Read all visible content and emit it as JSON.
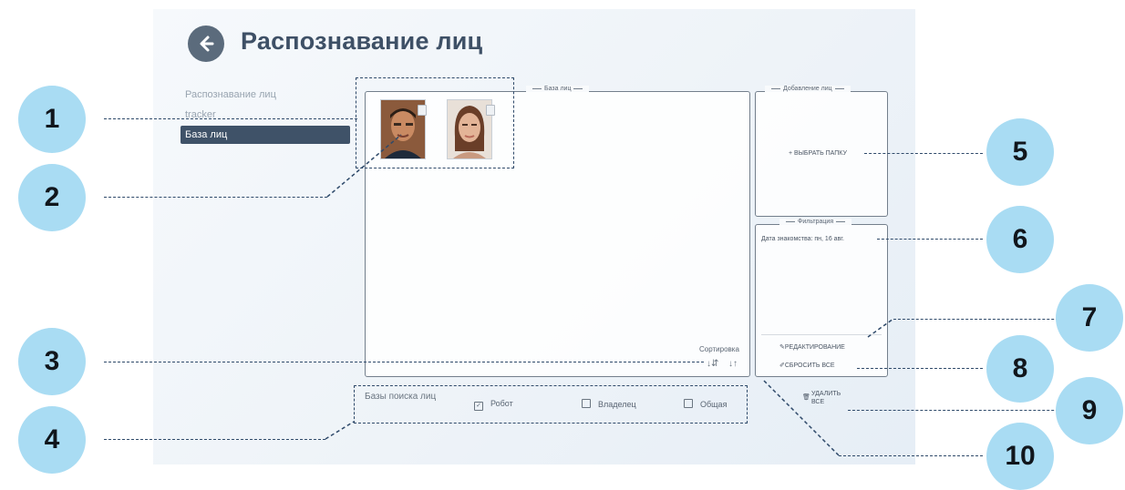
{
  "header": {
    "title": "Распознавание лиц"
  },
  "nav": {
    "items": [
      {
        "label": "Распознавание лиц"
      },
      {
        "label": "tracker"
      },
      {
        "label": "База лиц"
      }
    ]
  },
  "faces_panel": {
    "legend": "База лиц",
    "sort_label": "Сортировка",
    "sort_asc_icon": "↓⇵",
    "sort_desc_icon": "↓↑"
  },
  "add_panel": {
    "legend": "Добавление лиц",
    "choose_folder": "+ ВЫБРАТЬ ПАПКУ"
  },
  "filter_panel": {
    "legend": "Фильтрация",
    "date_text": "Дата знакомства: пн, 16 авг.",
    "edit_label": "РЕДАКТИРОВАНИЕ",
    "reset_label": "СБРОСИТЬ ВСЕ"
  },
  "search_bases": {
    "label": "Базы поиска лиц",
    "options": [
      {
        "label": "Робот",
        "checked": true
      },
      {
        "label": "Владелец",
        "checked": false
      },
      {
        "label": "Общая",
        "checked": false
      }
    ]
  },
  "delete_all": {
    "line1": "УДАЛИТЬ",
    "line2": "ВСЕ"
  },
  "callouts": [
    "1",
    "2",
    "3",
    "4",
    "5",
    "6",
    "7",
    "8",
    "9",
    "10"
  ],
  "colors": {
    "accent": "#3f5268",
    "callout": "#a9dcf3",
    "dash": "#2f4a6a"
  }
}
